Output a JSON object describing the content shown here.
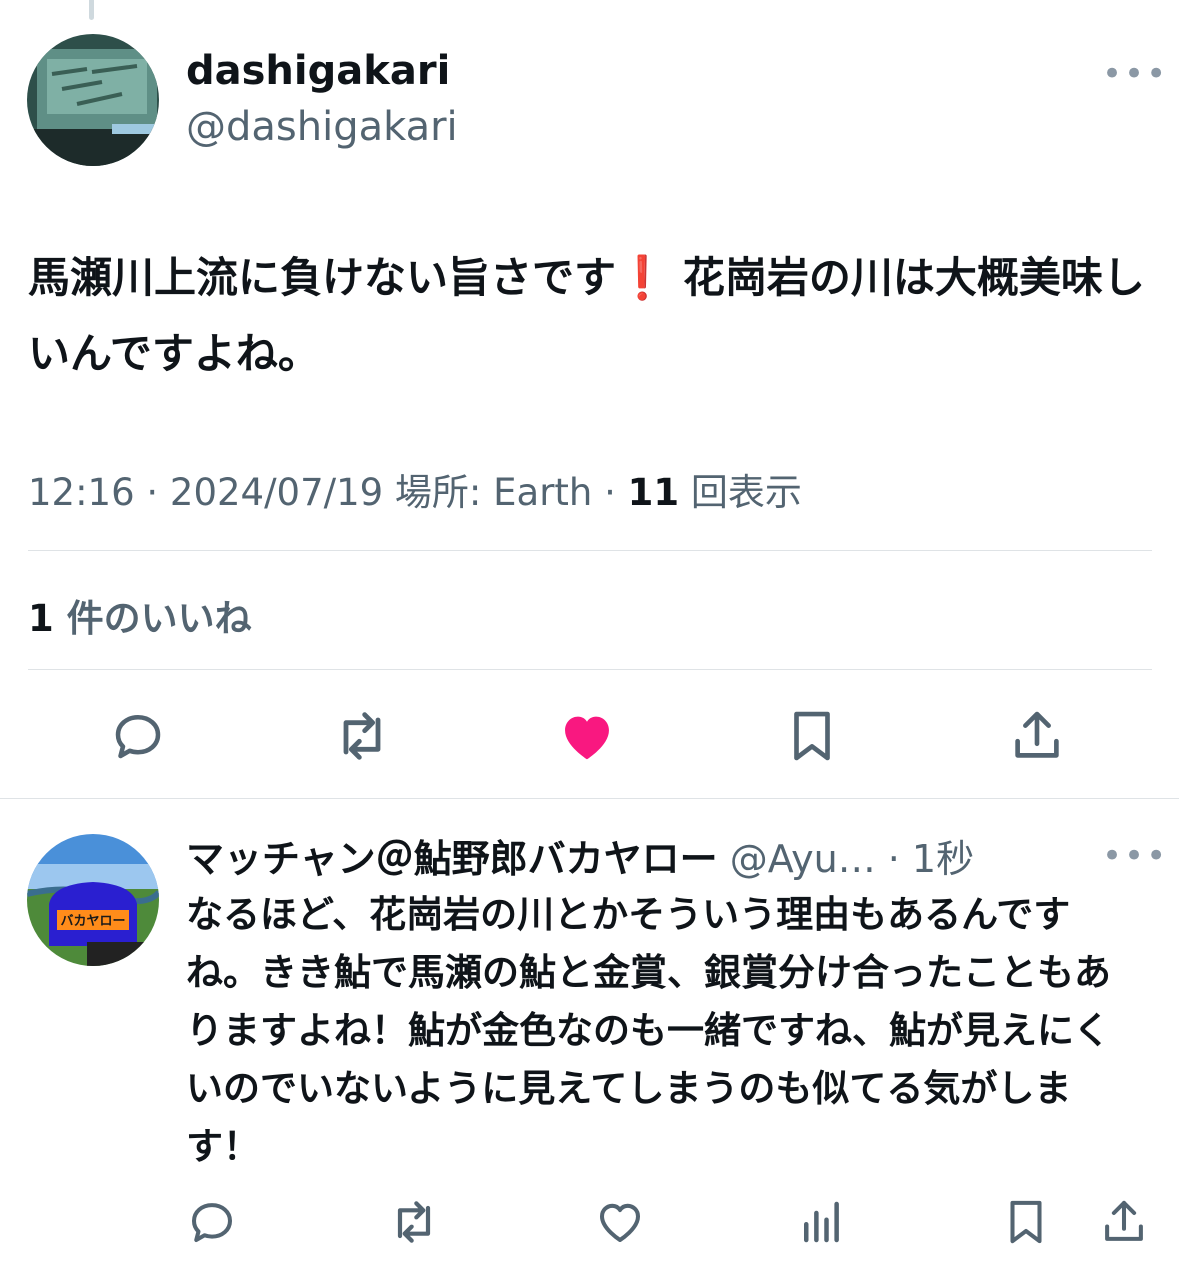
{
  "tweet": {
    "display_name": "dashigakari",
    "handle": "@dashigakari",
    "text_before": "馬瀬川上流に負けない旨さです",
    "emoji": "❗️",
    "text_after": " 花崗岩の川は大概美味しいんですよね。",
    "meta_prefix": "12:16 · 2024/07/19 場所: Earth · ",
    "views_count": "11",
    "views_label": " 回表示",
    "likes_count": "1",
    "likes_label": " 件のいいね",
    "more_icon": "•••"
  },
  "actions": {
    "reply_icon": "reply-icon",
    "retweet_icon": "retweet-icon",
    "like_icon": "heart-filled-icon",
    "like_color": "#f91880",
    "bookmark_icon": "bookmark-icon",
    "share_icon": "share-icon"
  },
  "reply": {
    "display_name": "マッチャン＠鮎野郎バカヤロー",
    "handle_time": " @Ayu… · 1秒",
    "text": "なるほど、花崗岩の川とかそういう理由もあるんですね。きき鮎で馬瀬の鮎と金賞、銀賞分け合ったこともありますよね！鮎が金色なのも一緒ですね、鮎が見えにくいのでいないように見えてしまうのも似てる気がします！",
    "more_icon": "•••",
    "cap_text": "バカヤロー"
  }
}
